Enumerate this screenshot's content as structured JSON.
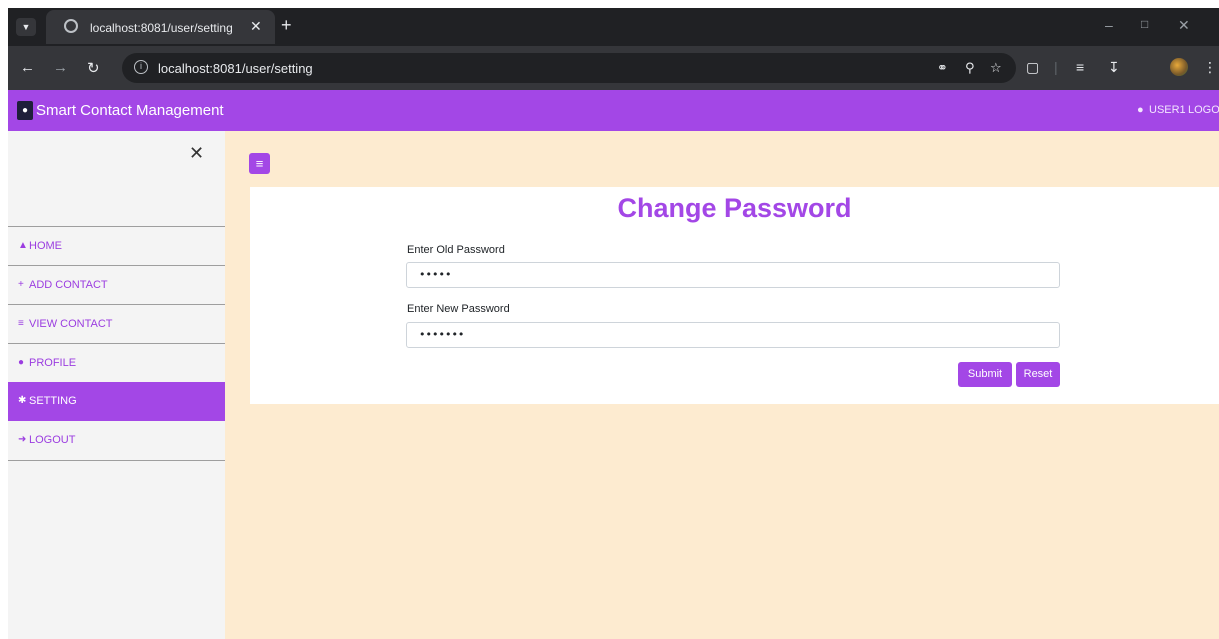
{
  "browser": {
    "tab_title": "localhost:8081/user/setting",
    "url": "localhost:8081/user/setting",
    "icons": [
      "tab-list-icon",
      "globe-icon",
      "close-icon",
      "plus-icon",
      "minimize-icon",
      "restore-icon",
      "back-icon",
      "forward-icon",
      "reload-icon",
      "info-icon",
      "key-icon",
      "zoom-icon",
      "star-icon",
      "extensions-icon",
      "reading-list-icon",
      "download-icon",
      "profile-icon",
      "menu-icon"
    ]
  },
  "app": {
    "brand": "Smart Contact Management",
    "user": "USER1",
    "logout": "LOGOUT",
    "accent_color": "#a347e6",
    "content_bg": "#fdebd0"
  },
  "sidebar": {
    "items": [
      {
        "label": "HOME",
        "icon": "home-icon"
      },
      {
        "label": "ADD CONTACT",
        "icon": "plus-icon"
      },
      {
        "label": "VIEW CONTACT",
        "icon": "list-icon"
      },
      {
        "label": "PROFILE",
        "icon": "user-icon"
      },
      {
        "label": "SETTING",
        "icon": "gear-icon",
        "active": true
      },
      {
        "label": "LOGOUT",
        "icon": "sign-out-icon"
      }
    ]
  },
  "form": {
    "title": "Change Password",
    "old_label": "Enter Old Password",
    "old_value": "•••••",
    "new_label": "Enter New Password",
    "new_value": "•••••••",
    "submit": "Submit",
    "reset": "Reset"
  }
}
